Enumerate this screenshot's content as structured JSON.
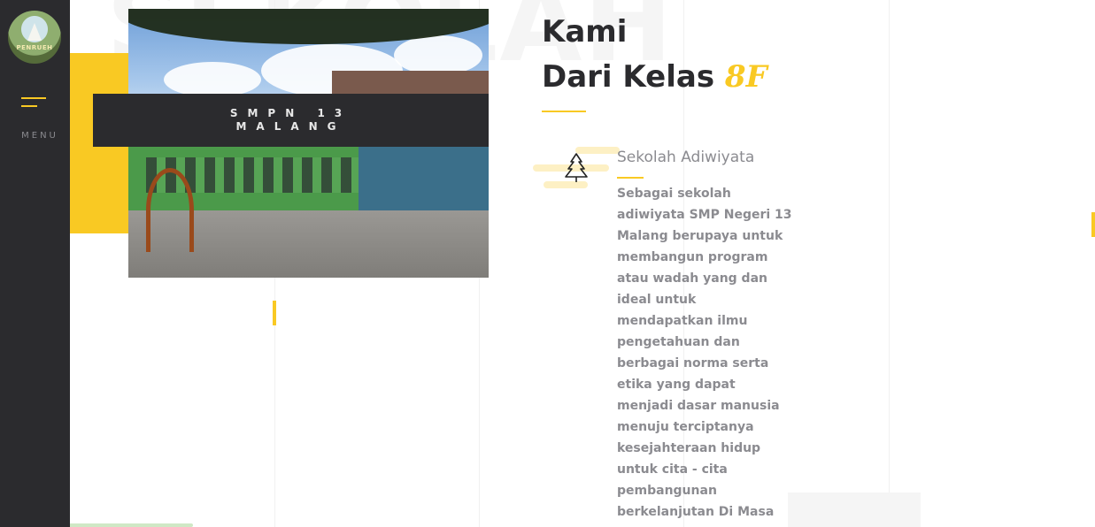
{
  "sidebar": {
    "logo_text": "PENRUEH",
    "menu_label": "MENU",
    "menu_icon": "hamburger-menu-icon"
  },
  "watermark": "SEKOLAH",
  "photo": {
    "caption_line1": "SMPN 13",
    "caption_line2": "MALANG"
  },
  "heading": {
    "line1": "Kami",
    "line2_prefix": "Dari Kelas ",
    "line2_accent": "8F"
  },
  "feature": {
    "icon": "pine-tree-icon",
    "title": "Sekolah Adiwiyata",
    "body_lines": [
      "Sebagai sekolah",
      "adiwiyata SMP Negeri 13",
      "Malang berupaya untuk",
      "membangun program",
      "atau wadah yang dan",
      "ideal untuk",
      "mendapatkan ilmu",
      "pengetahuan dan",
      "berbagai norma serta",
      "etika yang dapat",
      "menjadi dasar manusia",
      "menuju terciptanya",
      "kesejahteraan hidup",
      "untuk cita - cita",
      "pembangunan",
      "berkelanjutan Di Masa"
    ]
  },
  "colors": {
    "accent": "#f9c923",
    "sidebar": "#2b2b2e",
    "heading": "#2b2b2e",
    "body_text": "#8b8b90"
  }
}
